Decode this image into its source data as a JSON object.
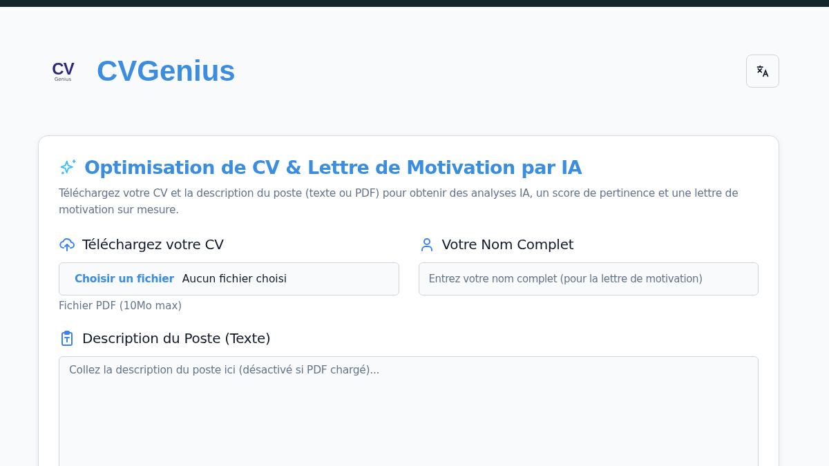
{
  "header": {
    "logo": {
      "letters": "CV",
      "caption": "Genius"
    },
    "title": "CVGenius"
  },
  "card": {
    "title": "Optimisation de CV & Lettre de Motivation par IA",
    "description": "Téléchargez votre CV et la description du poste (texte ou PDF) pour obtenir des analyses IA, un score de pertinence et une lettre de motivation sur mesure.",
    "cv_upload": {
      "label": "Téléchargez votre CV",
      "button": "Choisir un fichier",
      "status": "Aucun fichier choisi",
      "hint": "Fichier PDF (10Mo max)"
    },
    "full_name": {
      "label": "Votre Nom Complet",
      "placeholder": "Entrez votre nom complet (pour la lettre de motivation)"
    },
    "job_description": {
      "label": "Description du Poste (Texte)",
      "placeholder": "Collez la description du poste ici (désactivé si PDF chargé)..."
    }
  }
}
